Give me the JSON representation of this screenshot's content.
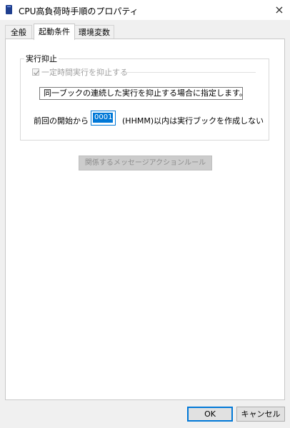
{
  "window": {
    "title": "CPU高負荷時手順のプロパティ",
    "close_symbol": "×"
  },
  "tabs": [
    "全般",
    "起動条件",
    "環境変数"
  ],
  "active_tab": "起動条件",
  "group": {
    "legend": "実行抑止",
    "checkbox_label": "一定時間実行を抑止する",
    "checkbox_checked": true,
    "checkbox_enabled": false,
    "description": "同一ブックの連続した実行を抑止する場合に指定します。",
    "start_label": "前回の開始から",
    "time_value": "0001",
    "unit_label": "(HHMM)以内は実行ブックを作成しない"
  },
  "related_rule_button": "関係するメッセージアクションルール",
  "footer": {
    "ok_label": "OK",
    "cancel_label": "キャンセル"
  },
  "colors": {
    "accent": "#0078d7",
    "disabled_text": "#a0a0a0",
    "app_icon": "#1f3f8f"
  }
}
